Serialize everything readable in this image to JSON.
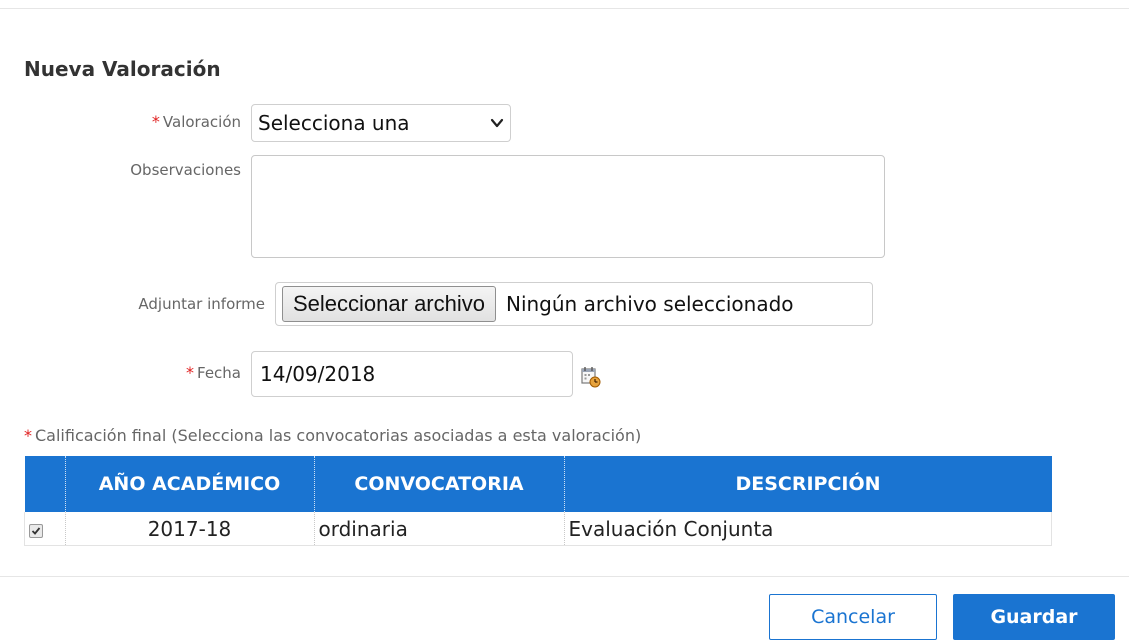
{
  "form": {
    "title": "Nueva Valoración",
    "required_mark": "*",
    "valoracion_label": "Valoración",
    "valoracion_value": "Selecciona una",
    "observaciones_label": "Observaciones",
    "observaciones_value": "",
    "adjuntar_label": "Adjuntar informe",
    "file_button_label": "Seleccionar archivo",
    "file_status": "Ningún archivo seleccionado",
    "fecha_label": "Fecha",
    "fecha_value": "14/09/2018",
    "calificacion_label": "Calificación final (Selecciona las convocatorias asociadas a esta valoración)"
  },
  "table": {
    "headers": [
      "",
      "AÑO ACADÉMICO",
      "CONVOCATORIA",
      "DESCRIPCIÓN"
    ],
    "rows": [
      {
        "checked": true,
        "anio": "2017-18",
        "convocatoria": "ordinaria",
        "descripcion": "Evaluación Conjunta"
      }
    ]
  },
  "actions": {
    "cancel_label": "Cancelar",
    "save_label": "Guardar"
  },
  "colors": {
    "accent": "#1a74d1",
    "required": "#e02020"
  },
  "icons": {
    "select_arrow": "chevron-down-icon",
    "calendar": "calendar-icon",
    "checkbox": "checkbox-checked-icon"
  }
}
